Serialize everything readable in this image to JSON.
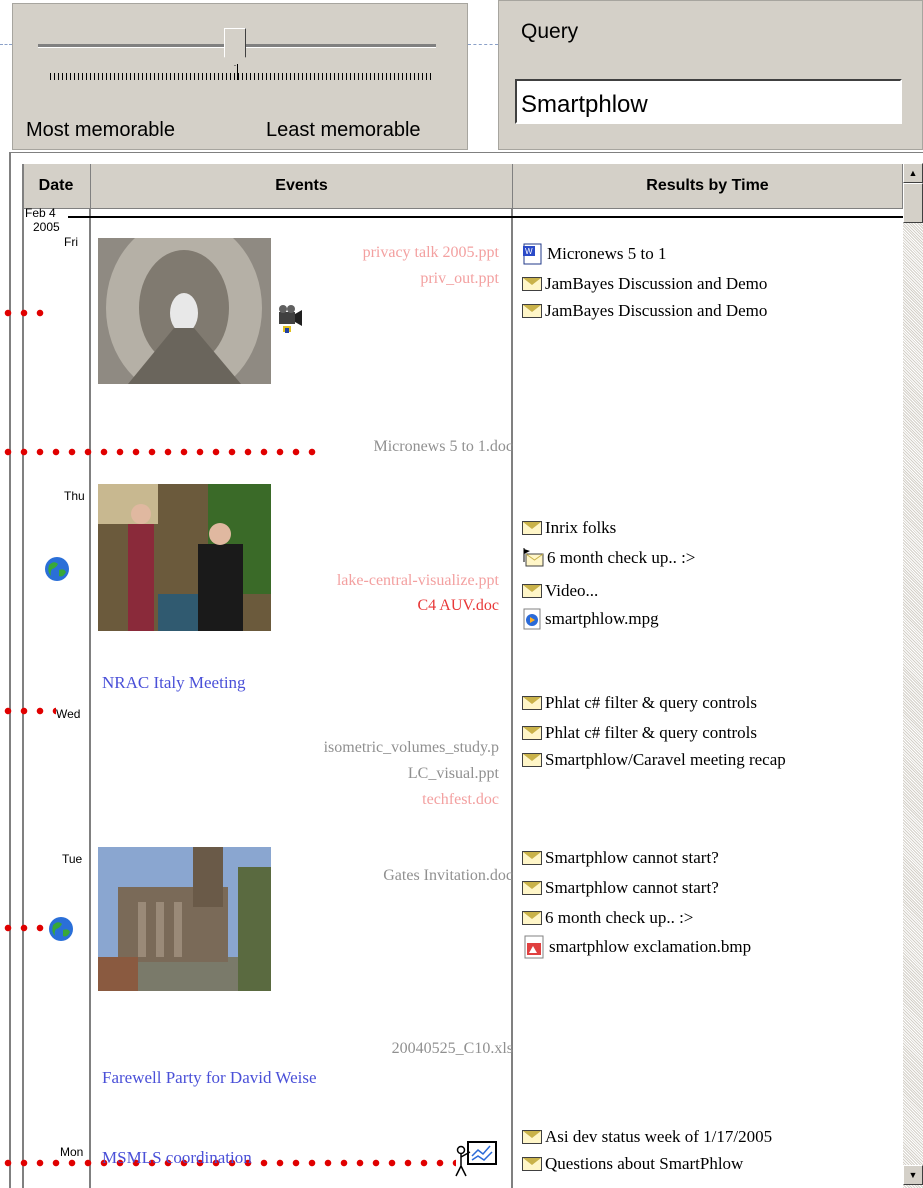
{
  "slider": {
    "left_label": "Most memorable",
    "right_label": "Least memorable"
  },
  "query": {
    "label": "Query",
    "value": "Smartphlow"
  },
  "columns": {
    "date": "Date",
    "events": "Events",
    "results": "Results by Time"
  },
  "date_header": {
    "month_day": "Feb 4",
    "year": "2005"
  },
  "days": [
    "Fri",
    "Thu",
    "Wed",
    "Tue",
    "Mon"
  ],
  "events": {
    "fri_files": [
      "privacy talk 2005.ppt",
      "priv_out.ppt"
    ],
    "fri_doc": "Micronews 5 to 1.doc",
    "thu_files": [
      "lake-central-visualize.ppt",
      "C4 AUV.doc"
    ],
    "wed_meeting": "NRAC Italy Meeting",
    "wed_files": [
      "isometric_volumes_study.p",
      "LC_visual.ppt",
      "techfest.doc"
    ],
    "tue_file": "Gates Invitation.doc",
    "tue_xls": "20040525_C10.xls",
    "tue_party": "Farewell Party for David Weise",
    "mon_meeting": "MSMLS coordination"
  },
  "results": {
    "fri": [
      {
        "icon": "word-doc-icon",
        "text": "Micronews 5 to 1"
      },
      {
        "icon": "email-icon",
        "text": "JamBayes Discussion and Demo"
      },
      {
        "icon": "email-icon",
        "text": "JamBayes Discussion and Demo"
      }
    ],
    "thu": [
      {
        "icon": "email-icon",
        "text": "Inrix folks"
      },
      {
        "icon": "email-flag-icon",
        "text": "6 month check up.. :>"
      },
      {
        "icon": "email-icon",
        "text": "Video..."
      },
      {
        "icon": "media-file-icon",
        "text": "smartphlow.mpg"
      }
    ],
    "wed": [
      {
        "icon": "email-icon",
        "text": "Phlat c# filter & query controls"
      },
      {
        "icon": "email-icon",
        "text": "Phlat c# filter & query controls"
      },
      {
        "icon": "email-icon",
        "text": "Smartphlow/Caravel meeting recap"
      }
    ],
    "tue": [
      {
        "icon": "email-icon",
        "text": "Smartphlow cannot start?"
      },
      {
        "icon": "email-icon",
        "text": "Smartphlow cannot start?"
      },
      {
        "icon": "email-icon",
        "text": "6 month check up.. :>"
      },
      {
        "icon": "bitmap-file-icon",
        "text": "smartphlow  exclamation.bmp"
      }
    ],
    "mon": [
      {
        "icon": "email-icon",
        "text": "Asi dev status week of 1/17/2005"
      },
      {
        "icon": "email-icon",
        "text": "Questions about SmartPhlow"
      }
    ]
  }
}
